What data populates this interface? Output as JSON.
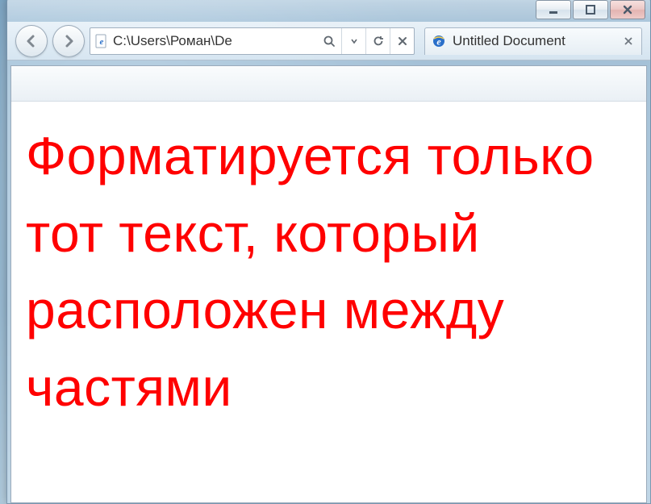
{
  "window": {
    "address": "C:\\Users\\Роман\\De",
    "tab_title": "Untitled Document"
  },
  "page": {
    "body_text": "Форматируется только тот текст, который расположен между частями"
  }
}
